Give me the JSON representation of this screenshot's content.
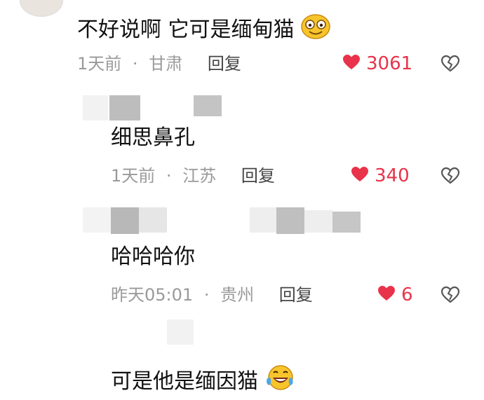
{
  "colors": {
    "like": "#e8334a",
    "meta": "#9a9a9a",
    "text": "#111111"
  },
  "comments": [
    {
      "text": "不好说啊 它可是缅甸猫",
      "emoji": "smile-emoji",
      "time": "1天前",
      "sep": "·",
      "location": "甘肃",
      "reply_label": "回复",
      "likes": "3061",
      "icons": [
        "heart-filled-icon",
        "heart-broken-icon"
      ]
    },
    {
      "text": "细思鼻孔",
      "time": "1天前",
      "sep": "·",
      "location": "江苏",
      "reply_label": "回复",
      "likes": "340",
      "icons": [
        "heart-filled-icon",
        "heart-broken-icon"
      ]
    },
    {
      "text": "哈哈哈你",
      "time": "昨天05:01",
      "sep": "·",
      "location": "贵州",
      "reply_label": "回复",
      "likes": "6",
      "icons": [
        "heart-filled-icon",
        "heart-broken-icon"
      ]
    },
    {
      "text": "可是他是缅因猫",
      "emoji": "laugh-tears-emoji"
    }
  ]
}
